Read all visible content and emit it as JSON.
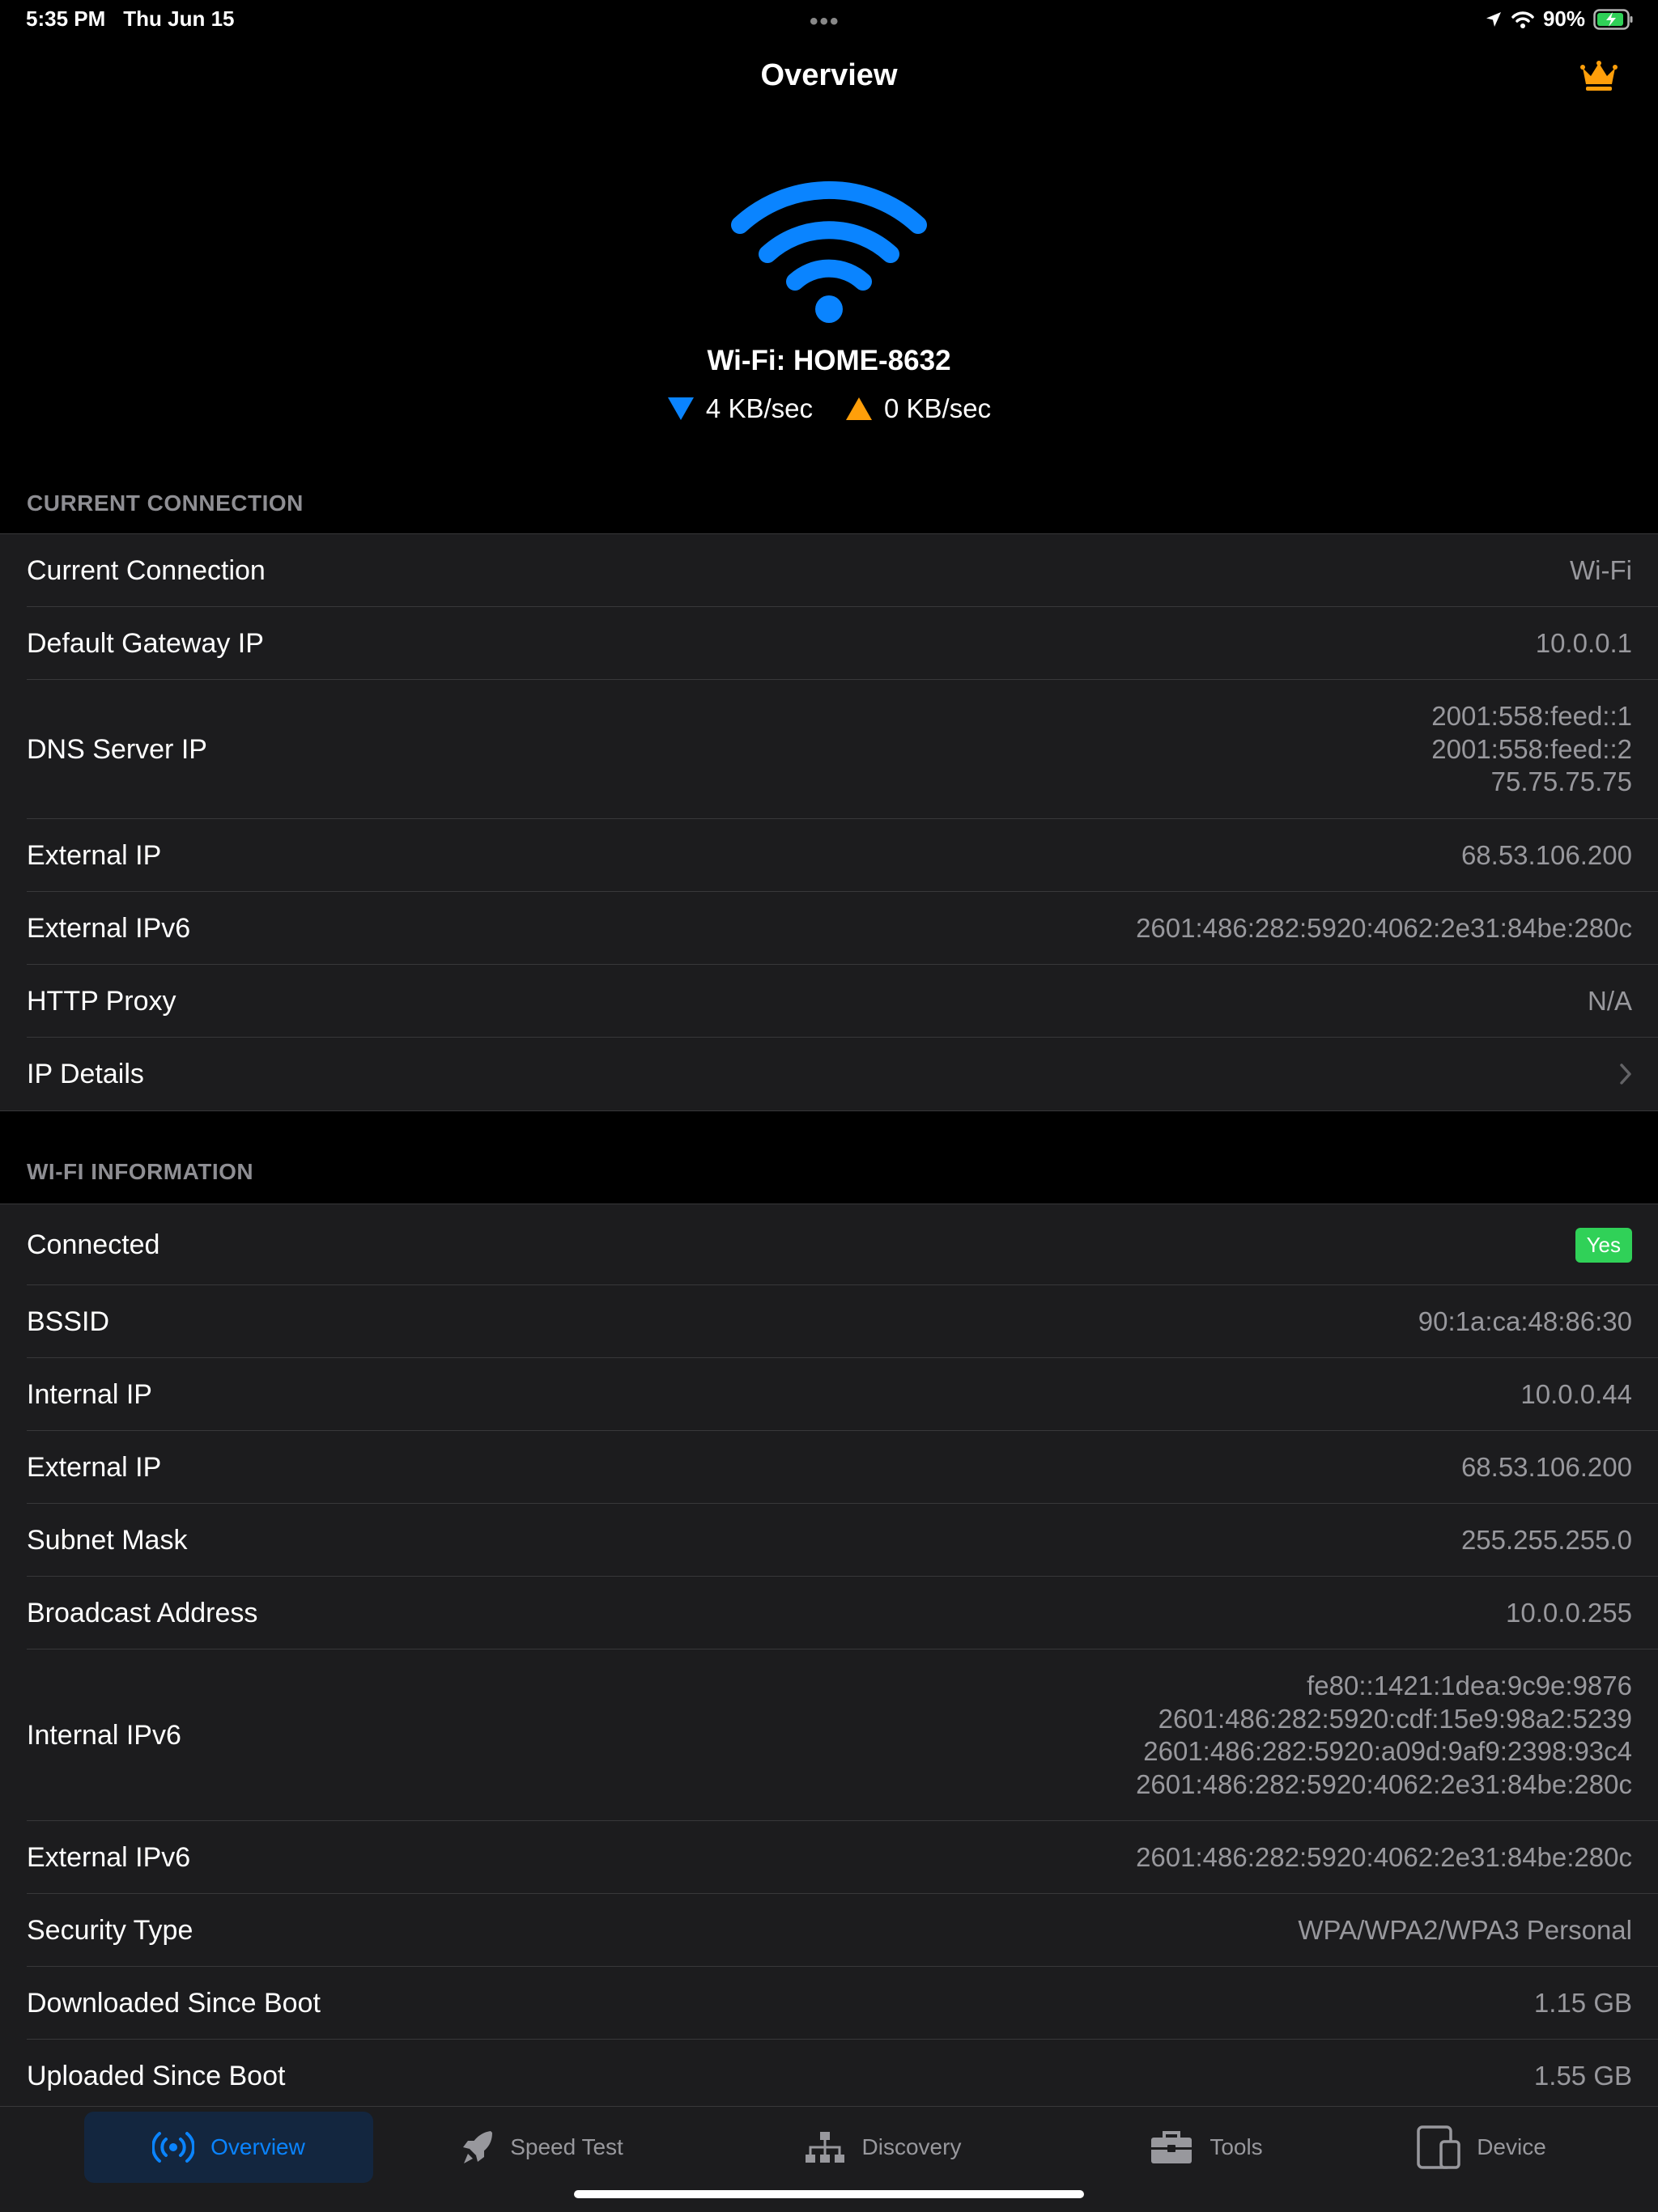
{
  "status_bar": {
    "time": "5:35 PM",
    "date": "Thu Jun 15",
    "battery": "90%",
    "icons": [
      "location-arrow-icon",
      "wifi-icon",
      "battery-charging-icon"
    ]
  },
  "nav": {
    "title": "Overview",
    "premium_icon": "crown-icon"
  },
  "hero": {
    "icon": "wifi-icon",
    "network": "Wi-Fi: HOME-8632",
    "download_rate": "4 KB/sec",
    "upload_rate": "0 KB/sec",
    "colors": {
      "accent": "#0a84ff",
      "upload": "#ff9f0a"
    }
  },
  "current_connection": {
    "header": "CURRENT CONNECTION",
    "rows": [
      {
        "label": "Current Connection",
        "value": "Wi-Fi"
      },
      {
        "label": "Default Gateway IP",
        "value": "10.0.0.1"
      },
      {
        "label": "DNS Server IP",
        "values": [
          "2001:558:feed::1",
          "2001:558:feed::2",
          "75.75.75.75"
        ]
      },
      {
        "label": "External IP",
        "value": "68.53.106.200"
      },
      {
        "label": "External IPv6",
        "value": "2601:486:282:5920:4062:2e31:84be:280c"
      },
      {
        "label": "HTTP Proxy",
        "value": "N/A"
      },
      {
        "label": "IP Details",
        "icon": "chevron-right-icon"
      }
    ]
  },
  "wifi_information": {
    "header": "WI-FI INFORMATION",
    "rows": [
      {
        "label": "Connected",
        "badge": "Yes",
        "badge_color": "#30d158"
      },
      {
        "label": "BSSID",
        "value": "90:1a:ca:48:86:30"
      },
      {
        "label": "Internal IP",
        "value": "10.0.0.44"
      },
      {
        "label": "External IP",
        "value": "68.53.106.200"
      },
      {
        "label": "Subnet Mask",
        "value": "255.255.255.0"
      },
      {
        "label": "Broadcast Address",
        "value": "10.0.0.255"
      },
      {
        "label": "Internal IPv6",
        "values": [
          "fe80::1421:1dea:9c9e:9876",
          "2601:486:282:5920:cdf:15e9:98a2:5239",
          "2601:486:282:5920:a09d:9af9:2398:93c4",
          "2601:486:282:5920:4062:2e31:84be:280c"
        ]
      },
      {
        "label": "External IPv6",
        "value": "2601:486:282:5920:4062:2e31:84be:280c"
      },
      {
        "label": "Security Type",
        "value": "WPA/WPA2/WPA3 Personal"
      },
      {
        "label": "Downloaded Since Boot",
        "value": "1.15 GB"
      },
      {
        "label": "Uploaded Since Boot",
        "value": "1.55 GB"
      }
    ]
  },
  "tabs": [
    {
      "label": "Overview",
      "icon": "broadcast-icon",
      "active": true
    },
    {
      "label": "Speed Test",
      "icon": "rocket-icon"
    },
    {
      "label": "Discovery",
      "icon": "network-tree-icon"
    },
    {
      "label": "Tools",
      "icon": "toolbox-icon"
    },
    {
      "label": "Device",
      "icon": "devices-icon"
    }
  ]
}
